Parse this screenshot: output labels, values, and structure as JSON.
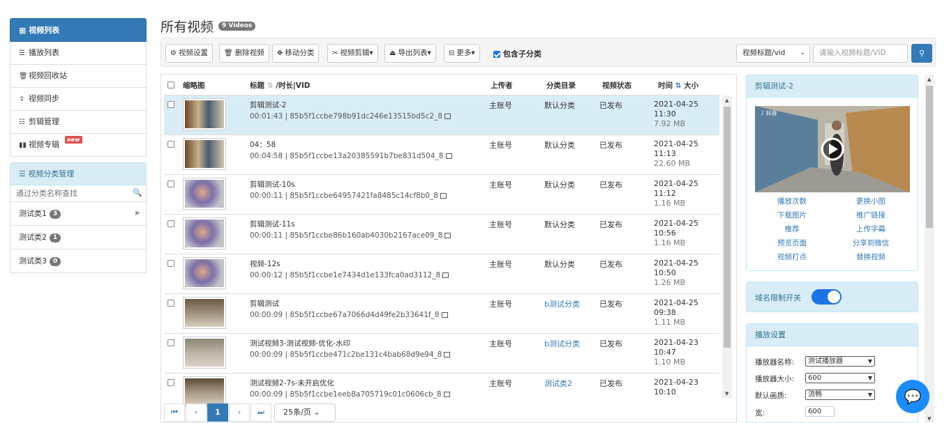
{
  "sidebar": {
    "header": "视频列表",
    "items": [
      {
        "label": "播放列表",
        "icon": "list-icon"
      },
      {
        "label": "视频回收站",
        "icon": "trash-icon"
      },
      {
        "label": "视频同步",
        "icon": "upload-icon"
      },
      {
        "label": "剪辑管理",
        "icon": "edit-icon"
      },
      {
        "label": "视频专辑",
        "icon": "album-icon",
        "badge": "new"
      }
    ],
    "category_header": "视频分类管理",
    "category_search_placeholder": "通过分类名称查找",
    "categories": [
      {
        "label": "测试类1",
        "count": "3"
      },
      {
        "label": "测试类2",
        "count": "1"
      },
      {
        "label": "测试类3",
        "count": "0"
      }
    ]
  },
  "page": {
    "title": "所有视频",
    "count_badge": "9 Videos"
  },
  "toolbar": {
    "video_settings": "视频设置",
    "delete_video": "删除视频",
    "move_category": "移动分类",
    "video_clip": "视频剪辑",
    "export_list": "导出列表",
    "more": "更多",
    "include_sub": "包含子分类",
    "search_field": "视频标题/vid",
    "search_placeholder": "请输入视频标题/VID"
  },
  "table": {
    "headers": {
      "thumb": "缩略图",
      "title": "标题",
      "title_rest": "/时长|VID",
      "uploader": "上传者",
      "category": "分类目录",
      "status": "视频状态",
      "time": "时间",
      "size": "大小"
    },
    "rows": [
      {
        "title": "剪辑测试-2",
        "meta": "00:01:43 | 85b5f1ccbe798b91dc246e13515bd5c2_8",
        "uploader": "主账号",
        "category": "默认分类",
        "status": "已发布",
        "date": "2021-04-25",
        "time": "11:30",
        "size": "7.92 MB"
      },
      {
        "title": "04：58",
        "meta": "00:04:58 | 85b5f1ccbe13a20385591b7be831d504_8",
        "uploader": "主账号",
        "category": "默认分类",
        "status": "已发布",
        "date": "2021-04-25",
        "time": "11:13",
        "size": "22.60 MB"
      },
      {
        "title": "剪辑测试-10s",
        "meta": "00:00:11 | 85b5f1ccbe64957421fa8485c14cf8b0_8",
        "uploader": "主账号",
        "category": "默认分类",
        "status": "已发布",
        "date": "2021-04-25",
        "time": "11:12",
        "size": "1.16 MB"
      },
      {
        "title": "剪辑测试-11s",
        "meta": "00:00:11 | 85b5f1ccbe86b160ab4030b2167ace09_8",
        "uploader": "主账号",
        "category": "默认分类",
        "status": "已发布",
        "date": "2021-04-25",
        "time": "10:56",
        "size": "1.16 MB"
      },
      {
        "title": "视频-12s",
        "meta": "00:00:12 | 85b5f1ccbe1e7434d1e133fca0ad3112_8",
        "uploader": "主账号",
        "category": "默认分类",
        "status": "已发布",
        "date": "2021-04-25",
        "time": "10:50",
        "size": "1.26 MB"
      },
      {
        "title": "剪辑测试",
        "meta": "00:00:09 | 85b5f1ccbe67a7066d4d49fe2b33641f_8",
        "uploader": "主账号",
        "category": "b测试分类",
        "status": "已发布",
        "date": "2021-04-25",
        "time": "09:38",
        "size": "1.11 MB"
      },
      {
        "title": "测试视频3-测试视频-优化-水印",
        "meta": "00:00:09 | 85b5f1ccbe471c2be131c4bab68d9e94_8",
        "uploader": "主账号",
        "category": "b测试分类",
        "status": "已发布",
        "date": "2021-04-23",
        "time": "10:47",
        "size": "1.10 MB"
      },
      {
        "title": "测试视频2-7s-未开启优化",
        "meta": "00:00:09 | 85b5f1ccbe1eeb8a705719c01c0606cb_8",
        "uploader": "主账号",
        "category": "测试类2",
        "status": "已发布",
        "date": "2021-04-23",
        "time": "10:10",
        "size": ""
      }
    ]
  },
  "pager": {
    "current": "1",
    "per_page": "25条/页"
  },
  "right": {
    "preview_title": "剪辑测试-2",
    "links": [
      "播放次数",
      "更换小图",
      "下载图片",
      "推广链接",
      "推荐",
      "上传字幕",
      "预览页面",
      "分享到微信",
      "视频打点",
      "替换视频"
    ],
    "domain_limit": "域名限制开关",
    "player_settings": "播放设置",
    "player_name_label": "播放器名称:",
    "player_name": "测试播放器",
    "player_size_label": "播放器大小:",
    "player_size": "600",
    "quality_label": "默认画质:",
    "quality": "流畅",
    "width_label": "宽:",
    "width": "600"
  },
  "colors": {
    "primary": "#337ab7",
    "accent": "#1a73e8",
    "panel_head": "#d9edf7"
  }
}
